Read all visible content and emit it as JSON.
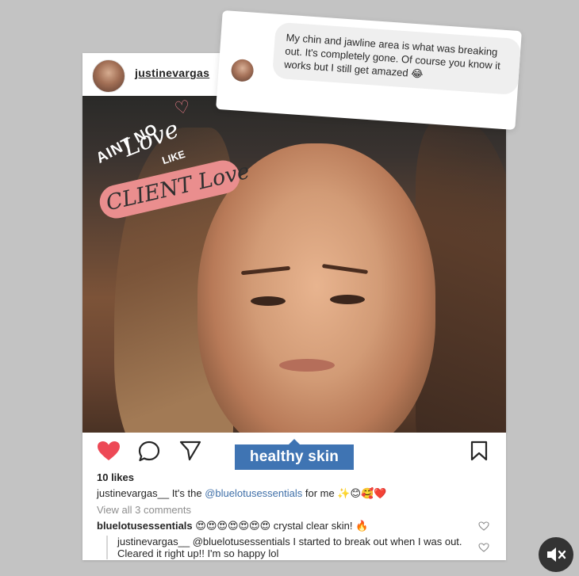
{
  "post": {
    "username": "justinevargas",
    "image_overlay": {
      "line1": "AINT NO",
      "line2": "Love",
      "line3": "LIKE",
      "banner": "CLIENT Love"
    },
    "hashtag": "healthy skin",
    "likes": "10 likes",
    "caption": {
      "author": "justinevargas__",
      "text_before": "It's the",
      "mention": "@bluelotusessentials",
      "text_after": "for me ✨😊🥰❤️"
    },
    "view_all_comments": "View all 3 comments",
    "comments": [
      {
        "author": "bluelotusessentials",
        "text": "😍😍😍😍😍😍😍 crystal clear skin! 🔥"
      },
      {
        "author": "justinevargas__",
        "mention": "@bluelotusessentials",
        "text": "I started to break out when I was out. Cleared it right up!! I'm so happy lol"
      }
    ]
  },
  "dm": {
    "message": "My chin and jawline area is what was breaking out. It's completely gone. Of course you know it works but I still get amazed 😂"
  },
  "icons": {
    "like": "heart-filled-icon",
    "comment": "comment-bubble-icon",
    "share": "paper-plane-icon",
    "save": "bookmark-icon",
    "comment_like": "heart-outline-icon",
    "sound": "speaker-muted-icon"
  },
  "colors": {
    "like_heart": "#ed4956",
    "hashtag_bg": "#3f74b3",
    "mention": "#3f6fa8",
    "banner": "#ea8e8e",
    "background": "#c3c3c3"
  }
}
